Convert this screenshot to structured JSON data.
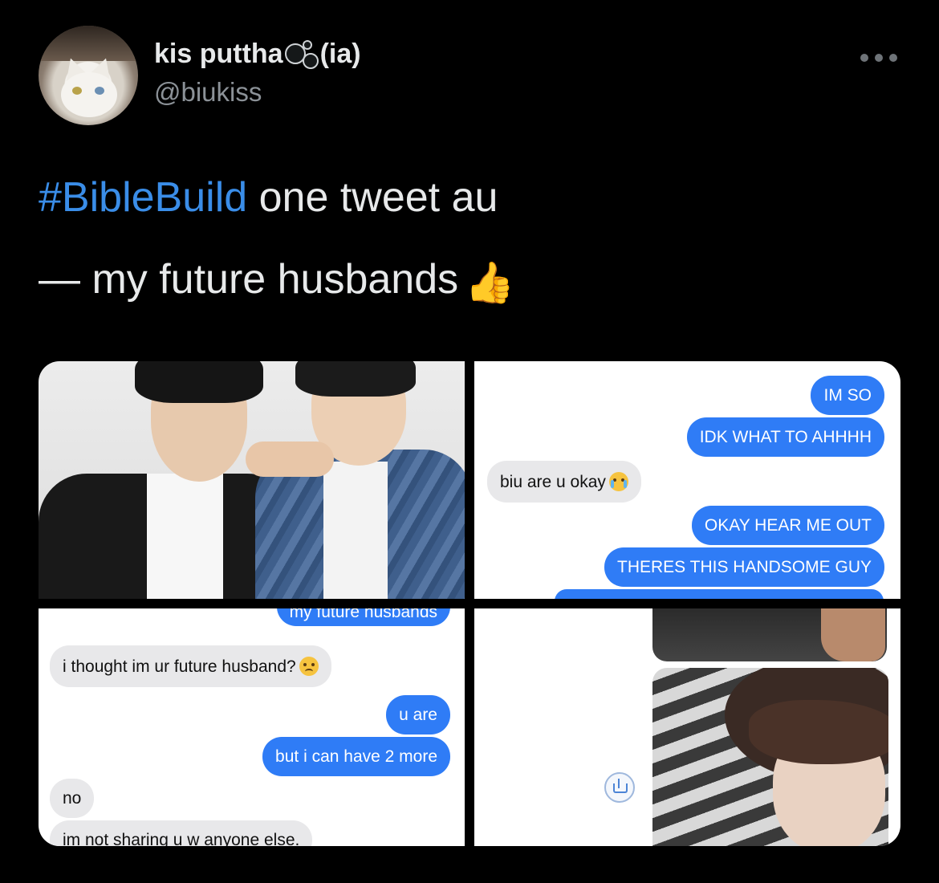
{
  "author": {
    "display_name": "kis puttha",
    "name_suffix": "(ia)",
    "handle": "@biukiss",
    "avatar": "avatar"
  },
  "menu": {
    "icon": "more-icon"
  },
  "tweet": {
    "hashtag": "#BibleBuild",
    "line1_rest": " one tweet au",
    "line2": "— my future husbands"
  },
  "media": {
    "chat1": {
      "sent_1": "IM SO",
      "sent_2": "IDK WHAT TO AHHHH",
      "recv_1": "biu are u okay",
      "sent_3": "OKAY HEAR ME OUT",
      "sent_4": "THERES THIS HANDSOME GUY"
    },
    "chat2": {
      "sent_cut": "my future husbands",
      "recv_1": "i thought im ur future husband?",
      "sent_1": "u are",
      "sent_2": "but i can have 2 more",
      "recv_2": "no",
      "recv_3": "im not sharing u w anyone else."
    }
  },
  "colors": {
    "background": "#000000",
    "hashtag": "#3a8de8",
    "sent_bubble": "#2f7cf6",
    "received_bubble": "#e8e8ea"
  }
}
